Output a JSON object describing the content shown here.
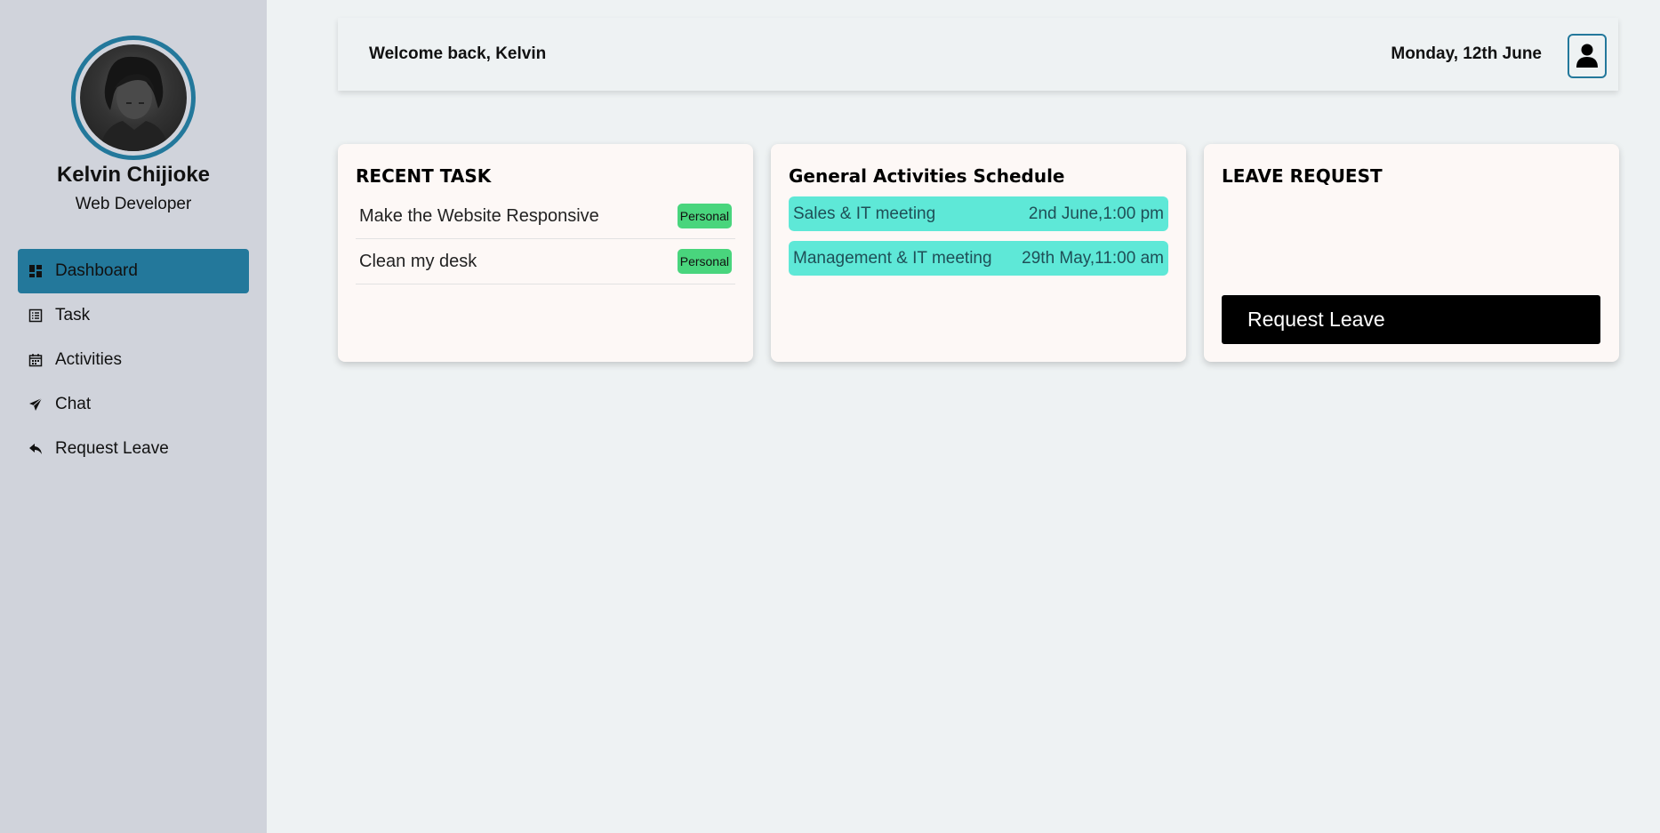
{
  "profile": {
    "name": "Kelvin Chijioke",
    "role": "Web Developer"
  },
  "nav": {
    "items": [
      {
        "label": "Dashboard",
        "icon": "dashboard-icon",
        "active": true
      },
      {
        "label": "Task",
        "icon": "task-list-icon",
        "active": false
      },
      {
        "label": "Activities",
        "icon": "calendar-icon",
        "active": false
      },
      {
        "label": "Chat",
        "icon": "paper-plane-icon",
        "active": false
      },
      {
        "label": "Request Leave",
        "icon": "reply-arrow-icon",
        "active": false
      }
    ]
  },
  "header": {
    "welcome": "Welcome back, Kelvin",
    "date": "Monday, 12th June"
  },
  "recent_task": {
    "title": "RECENT TASK",
    "tasks": [
      {
        "name": "Make the Website Responsive",
        "tag": "Personal"
      },
      {
        "name": "Clean my desk",
        "tag": "Personal"
      }
    ]
  },
  "activities": {
    "title": "General Activities Schedule",
    "items": [
      {
        "name": "Sales & IT meeting",
        "time": "2nd June,1:00 pm"
      },
      {
        "name": "Management & IT meeting",
        "time": "29th May,11:00 am"
      }
    ]
  },
  "leave": {
    "title": "LEAVE REQUEST",
    "button_label": "Request Leave"
  },
  "colors": {
    "accent": "#23789b",
    "sidebar_bg": "#d0d3db",
    "page_bg": "#eef2f3",
    "card_bg": "#fdf8f6",
    "badge_green": "#49d57d",
    "activity_teal": "#5ee8d7"
  }
}
